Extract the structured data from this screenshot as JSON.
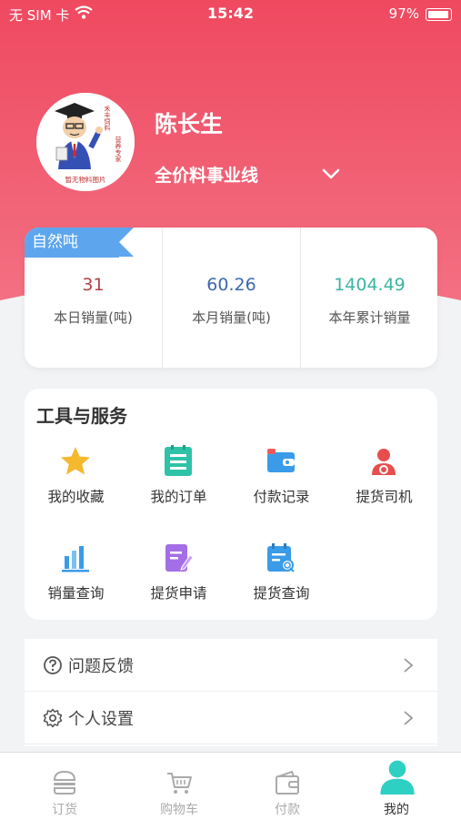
{
  "status_bar": {
    "carrier": "无 SIM 卡",
    "time": "15:42",
    "battery": "97%"
  },
  "profile": {
    "name": "陈长生",
    "business_line": "全价料事业线",
    "avatar_text": {
      "top_right": "禾丰饲料",
      "right": "营养专家",
      "bottom": "暂无物料图片"
    }
  },
  "stats": {
    "tag": "自然吨",
    "items": [
      {
        "value": "31",
        "label": "本日销量(吨)",
        "color": "#b1404a"
      },
      {
        "value": "60.26",
        "label": "本月销量(吨)",
        "color": "#3d67b0"
      },
      {
        "value": "1404.49",
        "label": "本年累计销量",
        "color": "#3bb5a2"
      }
    ]
  },
  "tools": {
    "title": "工具与服务",
    "items": [
      {
        "label": "我的收藏",
        "icon": "star-icon",
        "color": "#f5b82e"
      },
      {
        "label": "我的订单",
        "icon": "order-list-icon",
        "color": "#2ec3a8"
      },
      {
        "label": "付款记录",
        "icon": "wallet-icon",
        "color": "#3a9be8"
      },
      {
        "label": "提货司机",
        "icon": "driver-icon",
        "color": "#e84d4d"
      },
      {
        "label": "销量查询",
        "icon": "bar-chart-icon",
        "color": "#3a9be8"
      },
      {
        "label": "提货申请",
        "icon": "edit-form-icon",
        "color": "#a46ee6"
      },
      {
        "label": "提货查询",
        "icon": "search-doc-icon",
        "color": "#3a9be8"
      }
    ]
  },
  "menu": [
    {
      "label": "问题反馈",
      "icon": "question-circle-icon"
    },
    {
      "label": "个人设置",
      "icon": "gear-icon"
    }
  ],
  "tabbar": [
    {
      "label": "订货",
      "icon": "burger-icon",
      "active": false
    },
    {
      "label": "购物车",
      "icon": "cart-icon",
      "active": false
    },
    {
      "label": "付款",
      "icon": "wallet-icon",
      "active": false
    },
    {
      "label": "我的",
      "icon": "user-icon",
      "active": true
    }
  ],
  "colors": {
    "header_top": "#f04f63",
    "header_bottom": "#f26a7c",
    "accent_tag": "#5da6ee",
    "tab_active": "#2fd0c4"
  }
}
